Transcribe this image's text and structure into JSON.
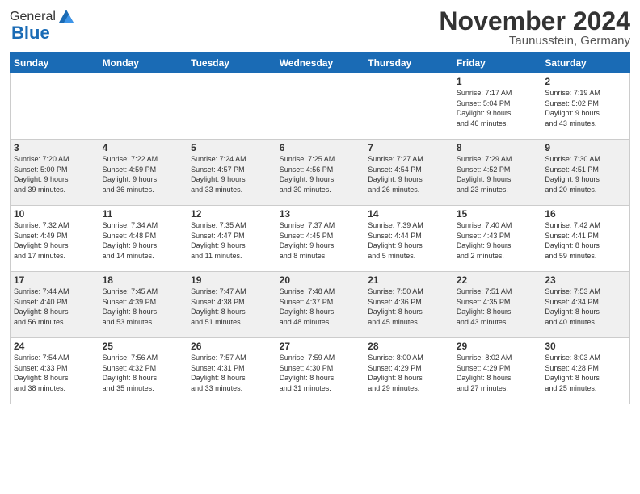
{
  "header": {
    "logo_general": "General",
    "logo_blue": "Blue",
    "month_title": "November 2024",
    "location": "Taunusstein, Germany"
  },
  "days_of_week": [
    "Sunday",
    "Monday",
    "Tuesday",
    "Wednesday",
    "Thursday",
    "Friday",
    "Saturday"
  ],
  "weeks": [
    [
      {
        "day": "",
        "info": ""
      },
      {
        "day": "",
        "info": ""
      },
      {
        "day": "",
        "info": ""
      },
      {
        "day": "",
        "info": ""
      },
      {
        "day": "",
        "info": ""
      },
      {
        "day": "1",
        "info": "Sunrise: 7:17 AM\nSunset: 5:04 PM\nDaylight: 9 hours\nand 46 minutes."
      },
      {
        "day": "2",
        "info": "Sunrise: 7:19 AM\nSunset: 5:02 PM\nDaylight: 9 hours\nand 43 minutes."
      }
    ],
    [
      {
        "day": "3",
        "info": "Sunrise: 7:20 AM\nSunset: 5:00 PM\nDaylight: 9 hours\nand 39 minutes."
      },
      {
        "day": "4",
        "info": "Sunrise: 7:22 AM\nSunset: 4:59 PM\nDaylight: 9 hours\nand 36 minutes."
      },
      {
        "day": "5",
        "info": "Sunrise: 7:24 AM\nSunset: 4:57 PM\nDaylight: 9 hours\nand 33 minutes."
      },
      {
        "day": "6",
        "info": "Sunrise: 7:25 AM\nSunset: 4:56 PM\nDaylight: 9 hours\nand 30 minutes."
      },
      {
        "day": "7",
        "info": "Sunrise: 7:27 AM\nSunset: 4:54 PM\nDaylight: 9 hours\nand 26 minutes."
      },
      {
        "day": "8",
        "info": "Sunrise: 7:29 AM\nSunset: 4:52 PM\nDaylight: 9 hours\nand 23 minutes."
      },
      {
        "day": "9",
        "info": "Sunrise: 7:30 AM\nSunset: 4:51 PM\nDaylight: 9 hours\nand 20 minutes."
      }
    ],
    [
      {
        "day": "10",
        "info": "Sunrise: 7:32 AM\nSunset: 4:49 PM\nDaylight: 9 hours\nand 17 minutes."
      },
      {
        "day": "11",
        "info": "Sunrise: 7:34 AM\nSunset: 4:48 PM\nDaylight: 9 hours\nand 14 minutes."
      },
      {
        "day": "12",
        "info": "Sunrise: 7:35 AM\nSunset: 4:47 PM\nDaylight: 9 hours\nand 11 minutes."
      },
      {
        "day": "13",
        "info": "Sunrise: 7:37 AM\nSunset: 4:45 PM\nDaylight: 9 hours\nand 8 minutes."
      },
      {
        "day": "14",
        "info": "Sunrise: 7:39 AM\nSunset: 4:44 PM\nDaylight: 9 hours\nand 5 minutes."
      },
      {
        "day": "15",
        "info": "Sunrise: 7:40 AM\nSunset: 4:43 PM\nDaylight: 9 hours\nand 2 minutes."
      },
      {
        "day": "16",
        "info": "Sunrise: 7:42 AM\nSunset: 4:41 PM\nDaylight: 8 hours\nand 59 minutes."
      }
    ],
    [
      {
        "day": "17",
        "info": "Sunrise: 7:44 AM\nSunset: 4:40 PM\nDaylight: 8 hours\nand 56 minutes."
      },
      {
        "day": "18",
        "info": "Sunrise: 7:45 AM\nSunset: 4:39 PM\nDaylight: 8 hours\nand 53 minutes."
      },
      {
        "day": "19",
        "info": "Sunrise: 7:47 AM\nSunset: 4:38 PM\nDaylight: 8 hours\nand 51 minutes."
      },
      {
        "day": "20",
        "info": "Sunrise: 7:48 AM\nSunset: 4:37 PM\nDaylight: 8 hours\nand 48 minutes."
      },
      {
        "day": "21",
        "info": "Sunrise: 7:50 AM\nSunset: 4:36 PM\nDaylight: 8 hours\nand 45 minutes."
      },
      {
        "day": "22",
        "info": "Sunrise: 7:51 AM\nSunset: 4:35 PM\nDaylight: 8 hours\nand 43 minutes."
      },
      {
        "day": "23",
        "info": "Sunrise: 7:53 AM\nSunset: 4:34 PM\nDaylight: 8 hours\nand 40 minutes."
      }
    ],
    [
      {
        "day": "24",
        "info": "Sunrise: 7:54 AM\nSunset: 4:33 PM\nDaylight: 8 hours\nand 38 minutes."
      },
      {
        "day": "25",
        "info": "Sunrise: 7:56 AM\nSunset: 4:32 PM\nDaylight: 8 hours\nand 35 minutes."
      },
      {
        "day": "26",
        "info": "Sunrise: 7:57 AM\nSunset: 4:31 PM\nDaylight: 8 hours\nand 33 minutes."
      },
      {
        "day": "27",
        "info": "Sunrise: 7:59 AM\nSunset: 4:30 PM\nDaylight: 8 hours\nand 31 minutes."
      },
      {
        "day": "28",
        "info": "Sunrise: 8:00 AM\nSunset: 4:29 PM\nDaylight: 8 hours\nand 29 minutes."
      },
      {
        "day": "29",
        "info": "Sunrise: 8:02 AM\nSunset: 4:29 PM\nDaylight: 8 hours\nand 27 minutes."
      },
      {
        "day": "30",
        "info": "Sunrise: 8:03 AM\nSunset: 4:28 PM\nDaylight: 8 hours\nand 25 minutes."
      }
    ]
  ]
}
